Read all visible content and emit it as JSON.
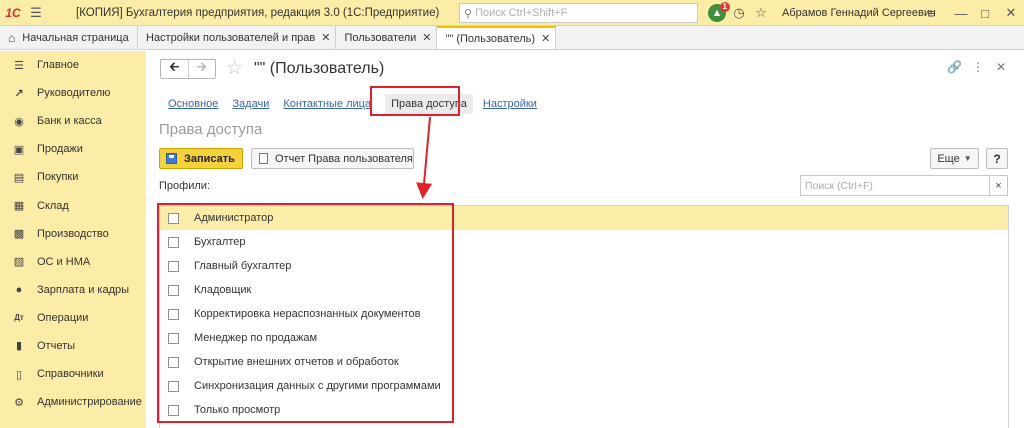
{
  "titlebar": {
    "logo": "1С",
    "title": "[КОПИЯ] Бухгалтерия предприятия, редакция 3.0  (1С:Предприятие)",
    "search_placeholder": "Поиск Ctrl+Shift+F",
    "notification_count": "1",
    "user": "Абрамов Геннадий Сергеевич"
  },
  "tabs": {
    "home": "Начальная страница",
    "open": [
      {
        "label": "Настройки пользователей и прав"
      },
      {
        "label": "Пользователи"
      },
      {
        "label": "\"\" (Пользователь)"
      }
    ]
  },
  "sidebar": {
    "items": [
      {
        "label": "Главное",
        "icon": "menu-icon"
      },
      {
        "label": "Руководителю",
        "icon": "trend-icon"
      },
      {
        "label": "Банк и касса",
        "icon": "coin-icon"
      },
      {
        "label": "Продажи",
        "icon": "bag-icon"
      },
      {
        "label": "Покупки",
        "icon": "cart-icon"
      },
      {
        "label": "Склад",
        "icon": "warehouse-icon"
      },
      {
        "label": "Производство",
        "icon": "factory-icon"
      },
      {
        "label": "ОС и НМА",
        "icon": "truck-icon"
      },
      {
        "label": "Зарплата и кадры",
        "icon": "person-icon"
      },
      {
        "label": "Операции",
        "icon": "operations-icon"
      },
      {
        "label": "Отчеты",
        "icon": "bar-chart-icon"
      },
      {
        "label": "Справочники",
        "icon": "books-icon"
      },
      {
        "label": "Администрирование",
        "icon": "gear-icon"
      }
    ]
  },
  "form": {
    "title": "\"\" (Пользователь)",
    "section_tabs": [
      "Основное",
      "Задачи",
      "Контактные лица",
      "Права доступа",
      "Настройки"
    ],
    "selected_section": "Права доступа",
    "section_heading": "Права доступа",
    "save_label": "Записать",
    "report_label": "Отчет Права пользователя",
    "more_label": "Еще",
    "help_label": "?",
    "profiles_label": "Профили:",
    "search_placeholder": "Поиск (Ctrl+F)",
    "profiles": [
      "Администратор",
      "Бухгалтер",
      "Главный бухгалтер",
      "Кладовщик",
      "Корректировка нераспознанных документов",
      "Менеджер по продажам",
      "Открытие внешних отчетов и обработок",
      "Синхронизация данных с другими программами",
      "Только просмотр"
    ]
  },
  "colors": {
    "accent_yellow": "#fbeca7",
    "button_yellow": "#f5d13b",
    "highlight_red": "#e0202a",
    "link_blue": "#3a66a8"
  }
}
